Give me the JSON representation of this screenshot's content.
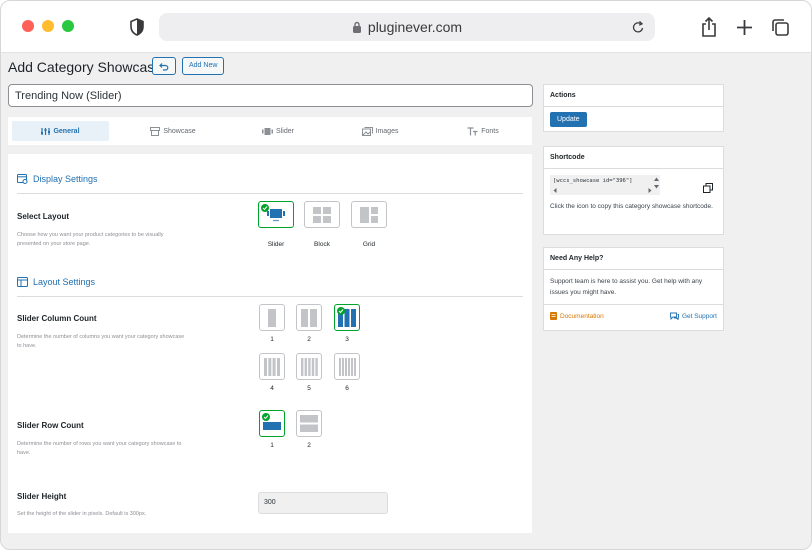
{
  "browser": {
    "url": "pluginever.com"
  },
  "page": {
    "title": "Add Category Showcase",
    "add_new_label": "Add New",
    "showcase_title_value": "Trending Now (Slider)"
  },
  "tabs": [
    {
      "label": "General",
      "icon": "sliders-icon",
      "active": true
    },
    {
      "label": "Showcase",
      "icon": "store-icon",
      "active": false
    },
    {
      "label": "Slider",
      "icon": "slider-icon",
      "active": false
    },
    {
      "label": "Images",
      "icon": "images-icon",
      "active": false
    },
    {
      "label": "Fonts",
      "icon": "font-icon",
      "active": false
    }
  ],
  "display_settings": {
    "heading": "Display Settings",
    "select_layout": {
      "label": "Select Layout",
      "description": "Choose how you want your product categories to be visually presented on your store page.",
      "options": [
        "Slider",
        "Block",
        "Grid"
      ],
      "selected": "Slider"
    }
  },
  "layout_settings": {
    "heading": "Layout Settings",
    "column_count": {
      "label": "Slider Column Count",
      "description": "Determine the number of columns you want your category showcase to have.",
      "options": [
        "1",
        "2",
        "3",
        "4",
        "5",
        "6"
      ],
      "selected": "3"
    },
    "row_count": {
      "label": "Slider Row Count",
      "description": "Determine the number of rows you want your category showcase to have.",
      "options": [
        "1",
        "2"
      ],
      "selected": "1"
    },
    "slider_height": {
      "label": "Slider Height",
      "description": "Set the height of the slider in pixels. Default is 300px.",
      "value": "300"
    }
  },
  "actions": {
    "title": "Actions",
    "update_label": "Update"
  },
  "shortcode": {
    "title": "Shortcode",
    "code": "[wccs_showcase id=\"396\"]",
    "help": "Click the icon to copy this category showcase shortcode."
  },
  "help_box": {
    "title": "Need Any Help?",
    "text": "Support team is here to assist you. Get help with any issues you might have.",
    "documentation_label": "Documentation",
    "support_label": "Get Support"
  },
  "colors": {
    "accent": "#2271b1",
    "selected": "#00a32a"
  }
}
